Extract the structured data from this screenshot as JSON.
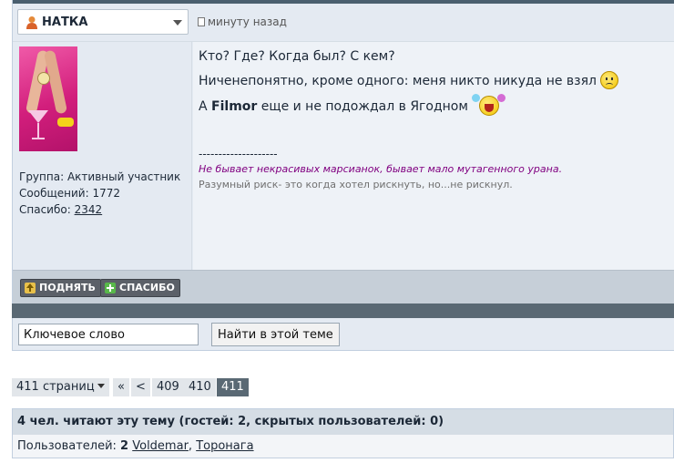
{
  "post": {
    "author": "НАТКА",
    "time": "минуту назад",
    "user_info": {
      "group_label": "Группа:",
      "group_value": "Активный участник",
      "posts_label": "Сообщений:",
      "posts_value": "1772",
      "thanks_label": "Спасибо:",
      "thanks_value": "2342"
    },
    "body": {
      "line1": "Кто? Где? Когда был? С кем?",
      "line2": "Ниченепонятно, кроме одного: меня никто никуда не взял",
      "line3_prefix": "А",
      "line3_bold": "Filmor",
      "line3_suffix": "еще и не подождал в Ягодном"
    },
    "signature": {
      "separator": "--------------------",
      "quote": "Не бывает некрасивых марсианок, бывает мало мутагенного урана.",
      "motto": "Разумный риск- это когда хотел рискнуть, но...не рискнул."
    },
    "buttons": {
      "raise": "ПОДНЯТЬ",
      "thanks": "СПАСИБО"
    }
  },
  "search": {
    "input_value": "Ключевое слово",
    "button": "Найти в этой теме"
  },
  "pager": {
    "pages_label": "411 страниц",
    "first": "«",
    "prev": "<",
    "pages": [
      "409",
      "410",
      "411"
    ],
    "current": "411"
  },
  "readers": {
    "header": "4 чел. читают эту тему (гостей: 2, скрытых пользователей: 0)",
    "users_label": "Пользователей:",
    "users_count": "2",
    "users": [
      "Voldemar",
      "Торонага"
    ]
  },
  "colors": {
    "topbar": "#4a5f6f",
    "post_bg": "#e4eaf2",
    "signature_quote": "#800080",
    "pager_active": "#5a6974"
  },
  "icons": [
    "user-icon",
    "chevron-down-icon",
    "document-icon",
    "sad-smiley-icon",
    "laughing-smiley-icon",
    "arrow-up-icon",
    "plus-icon"
  ]
}
